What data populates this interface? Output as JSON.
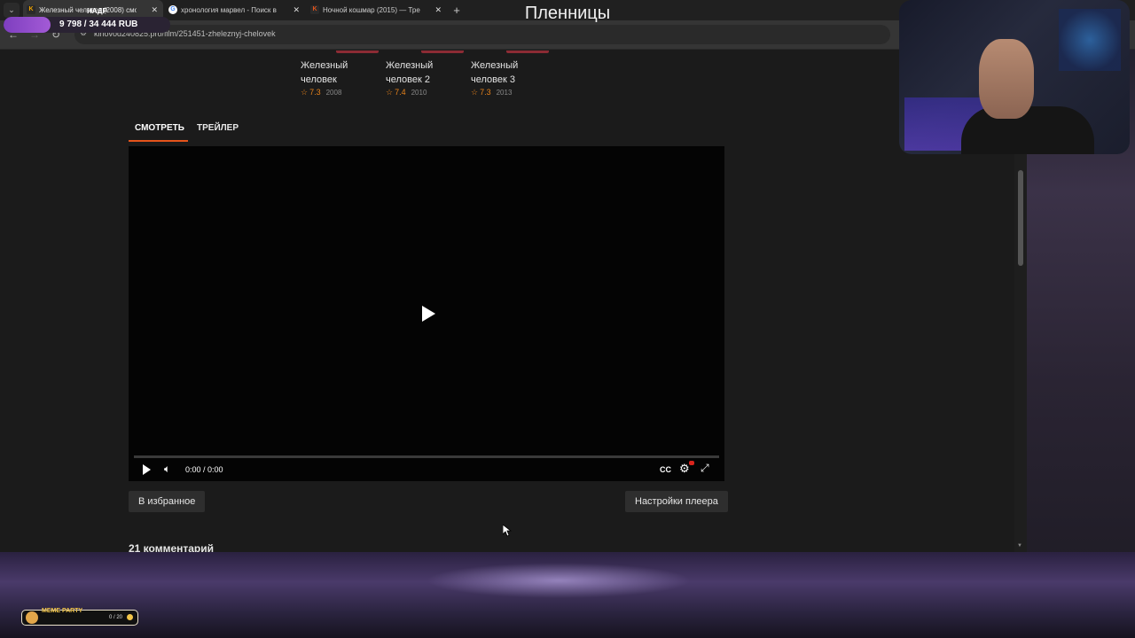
{
  "browser": {
    "tabs": [
      {
        "label": "Железный человек (2008) смотр",
        "favicon": "K",
        "favicon_color": "#f0a400",
        "active": true
      },
      {
        "label": "хронология марвел - Поиск в",
        "favicon": "G",
        "favicon_color": "#4285f4",
        "active": false
      },
      {
        "label": "Ночной кошмар (2015) — Тре",
        "favicon": "K",
        "favicon_color": "#e6541b",
        "active": false
      }
    ],
    "url": "kinovod240825.pro/film/251451-zheleznyj-chelovek"
  },
  "stream_overlay": {
    "title": "Пленницы",
    "goal_tag": "НАДР",
    "goal_text": "9 798 / 34 444 RUB",
    "goal_progress": 0.28
  },
  "related": [
    {
      "title": "Железный человек",
      "rating": "7.3",
      "year": "2008"
    },
    {
      "title": "Железный человек 2",
      "rating": "7.4",
      "year": "2010"
    },
    {
      "title": "Железный человек 3",
      "rating": "7.3",
      "year": "2013"
    }
  ],
  "player_tabs": {
    "watch": "СМОТРЕТЬ",
    "trailer": "ТРЕЙЛЕР"
  },
  "player": {
    "time": "0:00 / 0:00",
    "cc": "CC",
    "progress": 0
  },
  "buttons": {
    "favorites": "В избранное",
    "settings": "Настройки плеера"
  },
  "comments_heading": "21 комментарий",
  "meme_widget": {
    "label": "MEME PARTY",
    "count": "0 / 20"
  },
  "colors": {
    "accent": "#e6541b",
    "rating": "#e5821b",
    "badge": "#8c2b34",
    "goal": "#a35ad6"
  }
}
